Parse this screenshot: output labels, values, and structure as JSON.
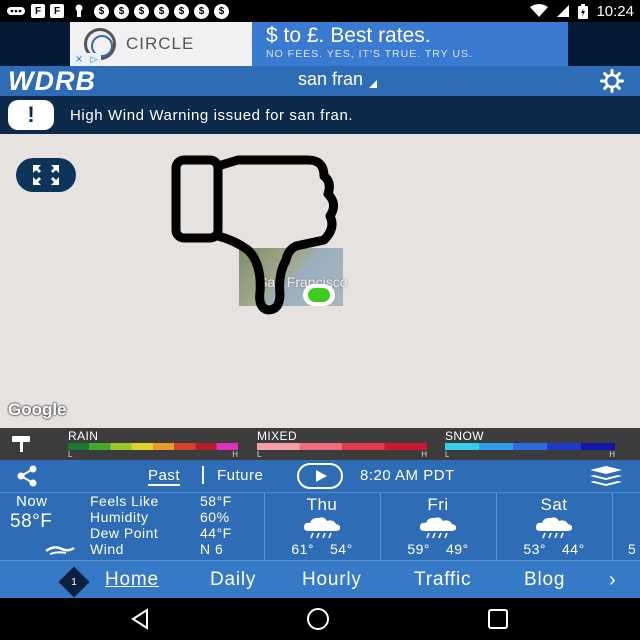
{
  "status_bar": {
    "time": "10:24",
    "notification_icons": [
      "phone-ringing-icon",
      "flipboard-icon",
      "flipboard-icon",
      "keyhole-icon",
      "dollar-icon",
      "dollar-icon",
      "dollar-icon",
      "dollar-icon",
      "dollar-icon",
      "dollar-icon",
      "dollar-icon"
    ],
    "system_icons": [
      "wifi-icon",
      "cell-signal-icon",
      "battery-charging-icon"
    ]
  },
  "ad": {
    "brand": "CIRCLE",
    "headline": "$ to £. Best rates.",
    "subline": "NO FEES. YES, IT'S TRUE. TRY US.",
    "choices_icons": [
      "close-x-icon",
      "adchoices-icon"
    ]
  },
  "header": {
    "logo": "WDRB",
    "location": "san fran",
    "settings_icon": "gear-icon"
  },
  "alert": {
    "icon": "exclamation-icon",
    "text": "High Wind Warning issued for san fran."
  },
  "map": {
    "city_label": "San Francisco",
    "attribution": "Google",
    "expand_icon": "expand-arrows-icon",
    "overlay_icon": "thumbs-down-icon"
  },
  "legend": {
    "groups": [
      {
        "label": "RAIN",
        "low": "L",
        "high": "H",
        "colors": [
          "#1c7a2f",
          "#45a82e",
          "#9ac72c",
          "#e1d22a",
          "#e69a2b",
          "#d5412a",
          "#b21e2b",
          "#e030c0"
        ]
      },
      {
        "label": "MIXED",
        "low": "L",
        "high": "H",
        "colors": [
          "#f5a0a8",
          "#ef6d7a",
          "#e23a4a",
          "#c81a2c"
        ]
      },
      {
        "label": "SNOW",
        "low": "L",
        "high": "H",
        "colors": [
          "#30d0e8",
          "#2d9ee8",
          "#2a6ce0",
          "#1e3ac8",
          "#1414a8"
        ]
      }
    ]
  },
  "controls": {
    "past_label": "Past",
    "future_label": "Future",
    "time": "8:20 AM PDT"
  },
  "current": {
    "now_label": "Now",
    "temp": "58°F",
    "stats": [
      {
        "label": "Feels Like",
        "value": "58°F"
      },
      {
        "label": "Humidity",
        "value": "60%"
      },
      {
        "label": "Dew Point",
        "value": "44°F"
      },
      {
        "label": "Wind",
        "value": "N 6"
      }
    ]
  },
  "forecast": [
    {
      "day": "Thu",
      "icon": "rain-cloud-icon",
      "high": "61°",
      "low": "54°"
    },
    {
      "day": "Fri",
      "icon": "rain-cloud-icon",
      "high": "59°",
      "low": "49°"
    },
    {
      "day": "Sat",
      "icon": "rain-cloud-icon",
      "high": "53°",
      "low": "44°"
    }
  ],
  "forecast_partial_high": "5",
  "nav": {
    "badge": "1",
    "home": "Home",
    "daily": "Daily",
    "hourly": "Hourly",
    "traffic": "Traffic",
    "blog": "Blog",
    "more": "›"
  }
}
